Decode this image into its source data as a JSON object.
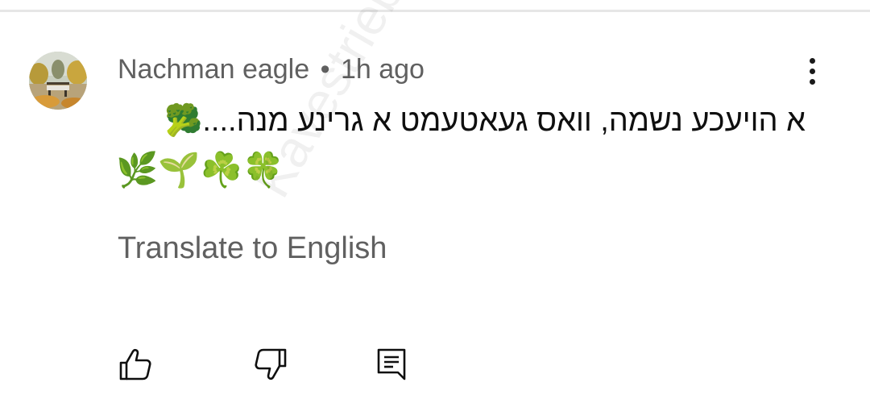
{
  "comment": {
    "author": "Nachman eagle",
    "separator": "•",
    "time": "1h ago",
    "text": "א הויעכע נשמה, וואס געאטעמט א גרינע מנה....🥦",
    "emojis": "🌿🌱☘️🍀",
    "translate_label": "Translate to English"
  },
  "watermark": {
    "text": "Kavestriebel.com"
  },
  "icons": {
    "more": "more-vert-icon",
    "like": "thumb-up-icon",
    "dislike": "thumb-down-icon",
    "reply": "reply-comment-icon"
  }
}
